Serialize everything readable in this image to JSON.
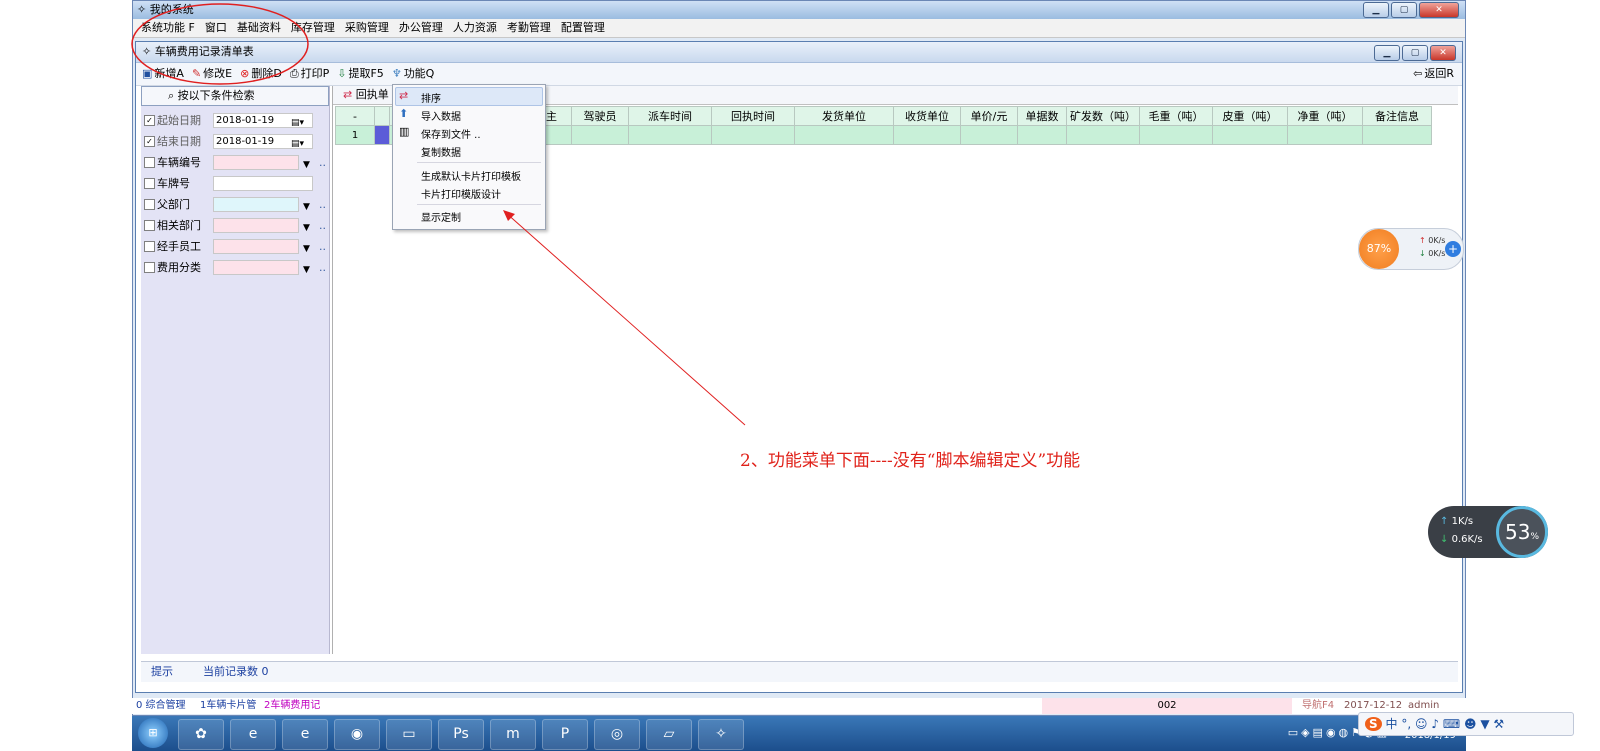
{
  "outer_window": {
    "title": "我的系统",
    "menu": [
      "系统功能 F",
      "窗口",
      "基础资料",
      "库存管理",
      "采购管理",
      "办公管理",
      "人力资源",
      "考勤管理",
      "配置管理"
    ]
  },
  "inner_window": {
    "title": "车辆费用记录清单表",
    "toolbar": {
      "new": "新增A",
      "edit": "修改E",
      "delete": "删除D",
      "print": "打印P",
      "extract": "提取F5",
      "function": "功能Q",
      "back": "返回R"
    }
  },
  "filter": {
    "header": "按以下条件检索",
    "start_date": {
      "label": "起始日期",
      "value": "2018-01-19",
      "checked": true
    },
    "end_date": {
      "label": "结束日期",
      "value": "2018-01-19",
      "checked": true
    },
    "vehicle_no": {
      "label": "车辆编号"
    },
    "plate_no": {
      "label": "车牌号"
    },
    "parent_dept": {
      "label": "父部门"
    },
    "related_dept": {
      "label": "相关部门"
    },
    "handler": {
      "label": "经手员工"
    },
    "fee_category": {
      "label": "费用分类"
    }
  },
  "grid": {
    "tab_label": "回执单",
    "columns": [
      "-",
      "",
      "",
      "属主",
      "驾驶员",
      "派车时间",
      "回执时间",
      "发货单位",
      "收货单位",
      "单价/元",
      "单据数",
      "矿发数（吨）",
      "毛重（吨）",
      "皮重（吨）",
      "净重（吨）",
      "备注信息"
    ],
    "rows": [
      [
        "1",
        "",
        "",
        "",
        "",
        "",
        "",
        "",
        "",
        "",
        "",
        "",
        "",
        "",
        "",
        ""
      ]
    ]
  },
  "context_menu": {
    "items": [
      "排序",
      "导入数据",
      "保存到文件 ..",
      "复制数据",
      "生成默认卡片打印模板",
      "卡片打印模版设计",
      "显示定制"
    ]
  },
  "status": {
    "hint": "提示",
    "record_count": "当前记录数 0"
  },
  "bottom_bar": {
    "tab0": "0 综合管理",
    "tab1": "1车辆卡片管",
    "tab2": "2车辆费用记",
    "code": "002",
    "nav": "导航F4",
    "date": "2017-12-12",
    "user": "admin"
  },
  "annotation": "2、功能菜单下面----没有“脚本编辑定义”功能",
  "widgets": {
    "cpu_percent": "87%",
    "up_small": "0K/s",
    "down_small": "0K/s",
    "mem_percent": "53",
    "mem_unit": "%",
    "up_rate": "1K/s",
    "down_rate": "0.6K/s"
  },
  "ime": {
    "lang": "中"
  },
  "clock": {
    "date": "2018/1/19"
  }
}
